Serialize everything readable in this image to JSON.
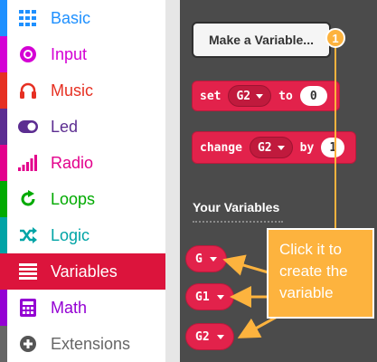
{
  "sidebar": {
    "items": [
      {
        "label": "Basic",
        "color": "#1e90ff",
        "icon": "grid-icon"
      },
      {
        "label": "Input",
        "color": "#d400d4",
        "icon": "target-icon"
      },
      {
        "label": "Music",
        "color": "#e63022",
        "icon": "headphones-icon"
      },
      {
        "label": "Led",
        "color": "#5c2d91",
        "icon": "toggle-icon"
      },
      {
        "label": "Radio",
        "color": "#e3008c",
        "icon": "signal-bars-icon"
      },
      {
        "label": "Loops",
        "color": "#00aa00",
        "icon": "loop-arrow-icon"
      },
      {
        "label": "Logic",
        "color": "#00a4a6",
        "icon": "shuffle-icon"
      },
      {
        "label": "Variables",
        "color": "#dc143c",
        "icon": "list-icon",
        "selected": true
      },
      {
        "label": "Math",
        "color": "#9400d3",
        "icon": "calculator-icon"
      },
      {
        "label": "Extensions",
        "color": "#666666",
        "icon": "plus-circle-icon"
      }
    ]
  },
  "flyout": {
    "make_variable_label": "Make a Variable...",
    "set_block": {
      "keyword": "set",
      "variable": "G2",
      "to": "to",
      "value": "0"
    },
    "change_block": {
      "keyword": "change",
      "variable": "G2",
      "by": "by",
      "value": "1"
    },
    "your_variables_heading": "Your Variables",
    "variables": [
      "G",
      "G1",
      "G2"
    ]
  },
  "annotation": {
    "badge_number": "1",
    "callout_lines": [
      "Click it to",
      "create the",
      "variable"
    ],
    "color": "#fdb33e"
  }
}
